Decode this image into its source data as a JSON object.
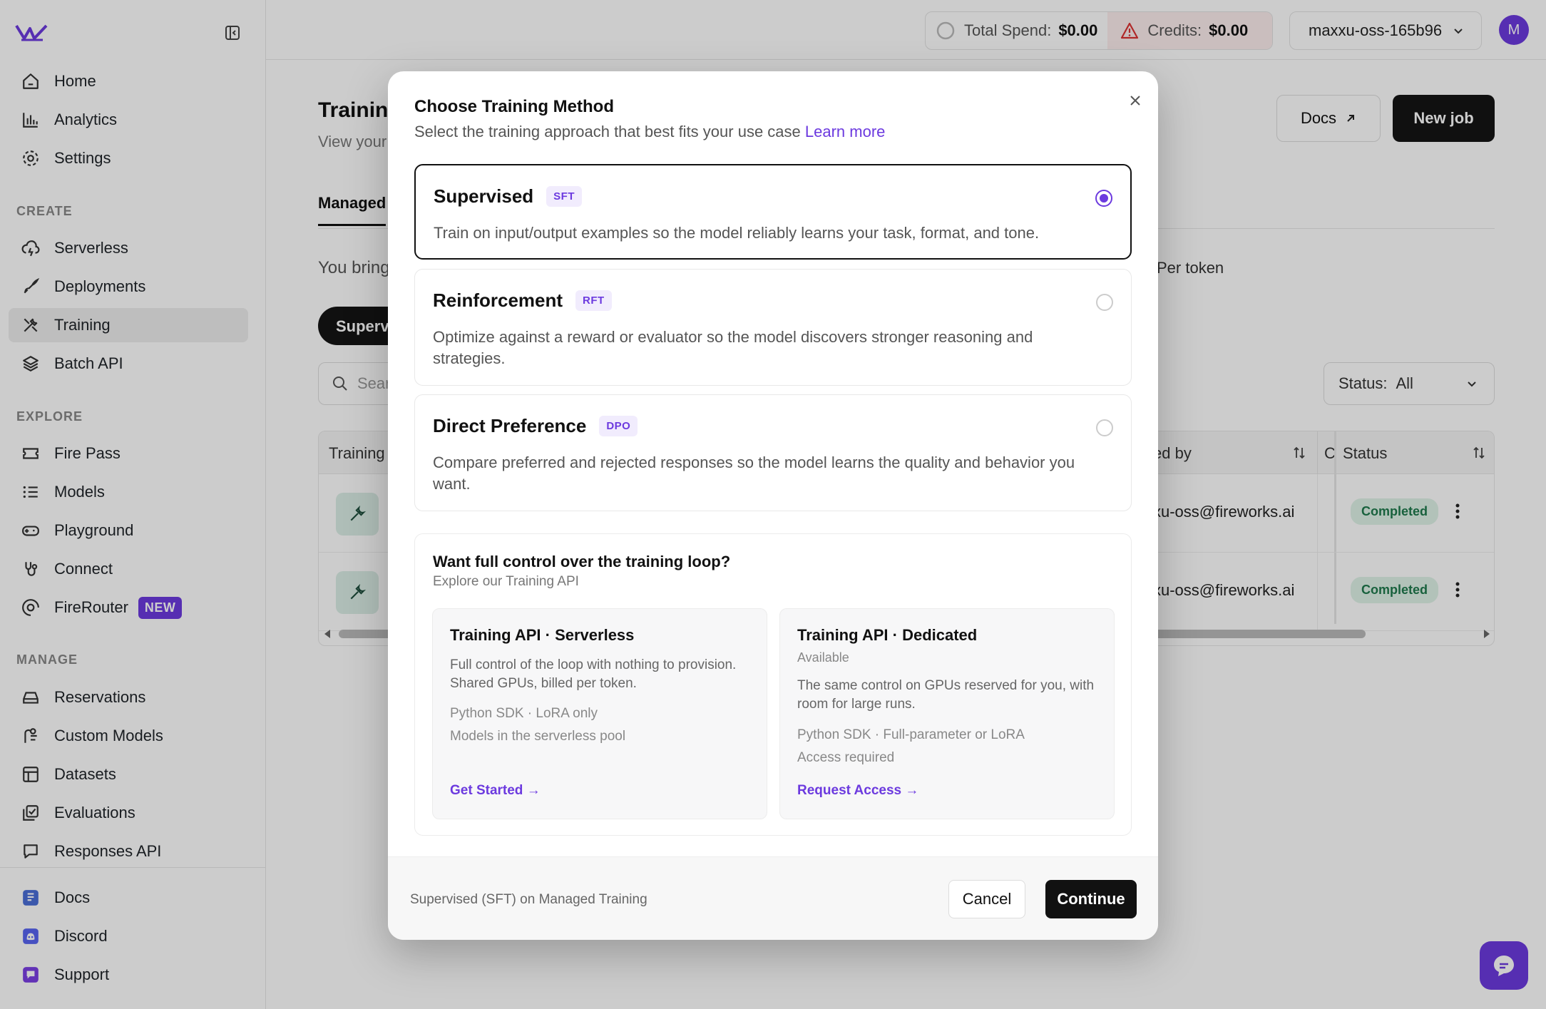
{
  "sidebar": {
    "items": [
      {
        "label": "Home"
      },
      {
        "label": "Analytics"
      },
      {
        "label": "Settings"
      }
    ],
    "sections": {
      "create": "CREATE",
      "explore": "EXPLORE",
      "manage": "MANAGE"
    },
    "create": [
      {
        "label": "Serverless"
      },
      {
        "label": "Deployments"
      },
      {
        "label": "Training"
      },
      {
        "label": "Batch API"
      }
    ],
    "explore": [
      {
        "label": "Fire Pass"
      },
      {
        "label": "Models"
      },
      {
        "label": "Playground"
      },
      {
        "label": "Connect"
      },
      {
        "label": "FireRouter",
        "badge": "NEW"
      }
    ],
    "manage": [
      {
        "label": "Reservations"
      },
      {
        "label": "Custom Models"
      },
      {
        "label": "Datasets"
      },
      {
        "label": "Evaluations"
      },
      {
        "label": "Responses API"
      }
    ],
    "bottom": [
      {
        "label": "Docs"
      },
      {
        "label": "Discord"
      },
      {
        "label": "Support"
      }
    ]
  },
  "topbar": {
    "spend_label": "Total Spend:",
    "spend_value": "$0.00",
    "credits_label": "Credits:",
    "credits_value": "$0.00",
    "account": "maxxu-oss-165b96",
    "avatar": "M"
  },
  "main": {
    "title": "Training",
    "subtitle": "View your",
    "docs_button": "Docs",
    "new_job_button": "New job",
    "tab_managed": "Managed",
    "you_bring": "You bring",
    "per_token": "Per token",
    "pill": "Superv",
    "search_placeholder": "Sear",
    "status_label": "Status:",
    "status_value": "All",
    "table": {
      "headers": {
        "training": "Training",
        "created_by": "ed by",
        "c": "C",
        "status": "Status"
      },
      "rows": [
        {
          "email": "xu-oss@fireworks.ai",
          "status": "Completed"
        },
        {
          "email": "xu-oss@fireworks.ai",
          "status": "Completed"
        }
      ]
    }
  },
  "modal": {
    "title": "Choose Training Method",
    "subtitle": "Select the training approach that best fits your use case",
    "learn_more": "Learn more",
    "options": [
      {
        "name": "Supervised",
        "tag": "SFT",
        "desc": "Train on input/output examples so the model reliably learns your task, format, and tone.",
        "selected": true
      },
      {
        "name": "Reinforcement",
        "tag": "RFT",
        "desc": "Optimize against a reward or evaluator so the model discovers stronger reasoning and strategies.",
        "selected": false
      },
      {
        "name": "Direct Preference",
        "tag": "DPO",
        "desc": "Compare preferred and rejected responses so the model learns the quality and behavior you want.",
        "selected": false
      }
    ],
    "api": {
      "title": "Want full control over the training loop?",
      "subtitle": "Explore our Training API",
      "cards": [
        {
          "title": "Training API · Serverless",
          "desc": "Full control of the loop with nothing to provision. Shared GPUs, billed per token.",
          "meta1": "Python SDK · LoRA only",
          "meta2": "Models in the serverless pool",
          "link": "Get Started →"
        },
        {
          "title": "Training API · Dedicated",
          "availability": "Available",
          "desc": "The same control on GPUs reserved for you, with room for large runs.",
          "meta1": "Python SDK · Full-parameter or LoRA",
          "meta2": "Access required",
          "link": "Request Access →"
        }
      ]
    },
    "footer_text": "Supervised (SFT) on Managed Training",
    "cancel": "Cancel",
    "continue": "Continue"
  },
  "colors": {
    "accent": "#6c3adf",
    "success_bg": "#dff3e8",
    "success_text": "#1f7a4d"
  }
}
